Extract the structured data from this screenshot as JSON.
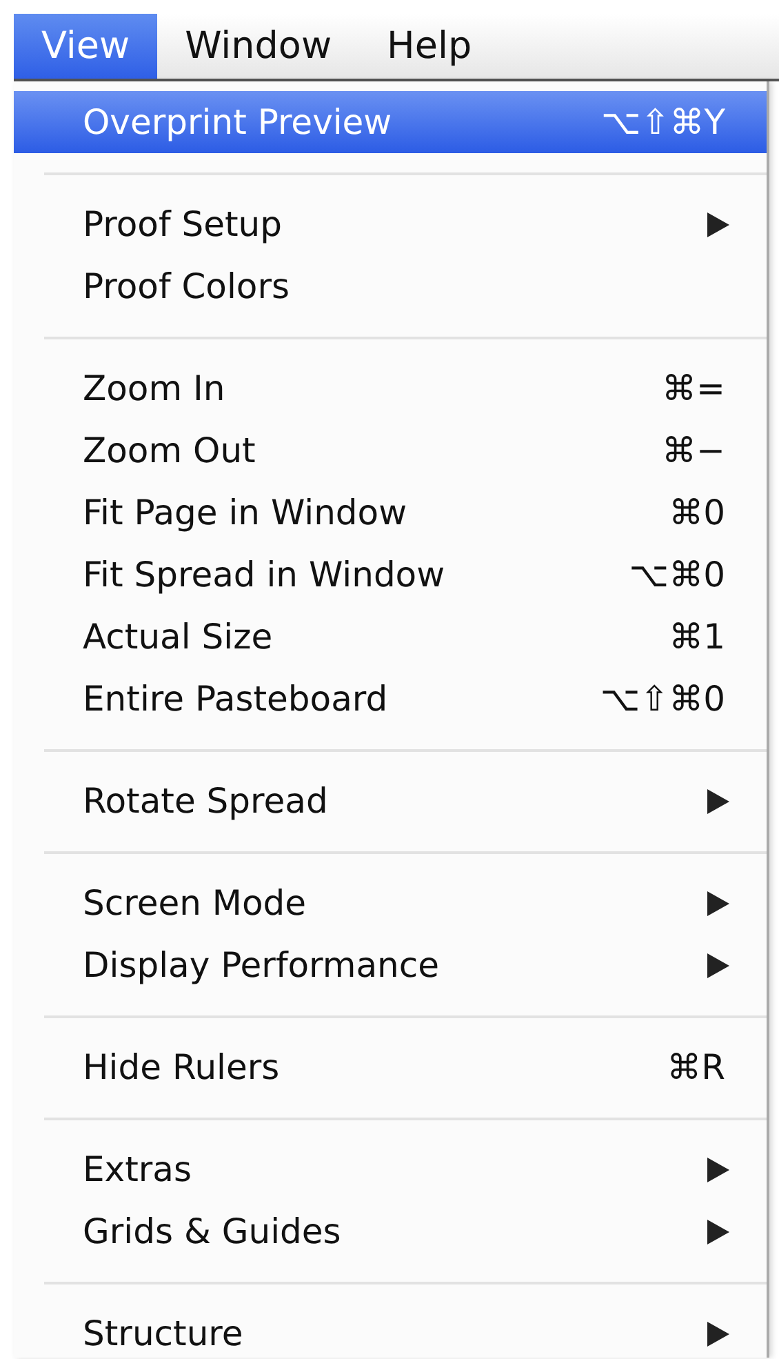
{
  "menu_bar": [
    {
      "label": "View",
      "selected": true
    },
    {
      "label": "Window",
      "selected": false
    },
    {
      "label": "Help",
      "selected": false
    }
  ],
  "menu": {
    "groups": [
      {
        "items": [
          {
            "label": "Overprint Preview",
            "shortcut": "⌥⇧⌘Y",
            "has_submenu": false,
            "selected": true
          }
        ]
      },
      {
        "items": [
          {
            "label": "Proof Setup",
            "has_submenu": true,
            "selected": false
          },
          {
            "label": "Proof Colors",
            "has_submenu": false,
            "selected": false
          }
        ]
      },
      {
        "items": [
          {
            "label": "Zoom In",
            "shortcut": "⌘=",
            "has_submenu": false,
            "selected": false
          },
          {
            "label": "Zoom Out",
            "shortcut": "⌘−",
            "has_submenu": false,
            "selected": false
          },
          {
            "label": "Fit Page in Window",
            "shortcut": "⌘0",
            "has_submenu": false,
            "selected": false
          },
          {
            "label": "Fit Spread in Window",
            "shortcut": "⌥⌘0",
            "has_submenu": false,
            "selected": false
          },
          {
            "label": "Actual Size",
            "shortcut": "⌘1",
            "has_submenu": false,
            "selected": false
          },
          {
            "label": "Entire Pasteboard",
            "shortcut": "⌥⇧⌘0",
            "has_submenu": false,
            "selected": false
          }
        ]
      },
      {
        "items": [
          {
            "label": "Rotate Spread",
            "has_submenu": true,
            "selected": false
          }
        ]
      },
      {
        "items": [
          {
            "label": "Screen Mode",
            "has_submenu": true,
            "selected": false
          },
          {
            "label": "Display Performance",
            "has_submenu": true,
            "selected": false
          }
        ]
      },
      {
        "items": [
          {
            "label": "Hide Rulers",
            "shortcut": "⌘R",
            "has_submenu": false,
            "selected": false
          }
        ]
      },
      {
        "items": [
          {
            "label": "Extras",
            "has_submenu": true,
            "selected": false
          },
          {
            "label": "Grids & Guides",
            "has_submenu": true,
            "selected": false
          }
        ]
      },
      {
        "items": [
          {
            "label": "Structure",
            "has_submenu": true,
            "selected": false
          }
        ]
      }
    ]
  }
}
